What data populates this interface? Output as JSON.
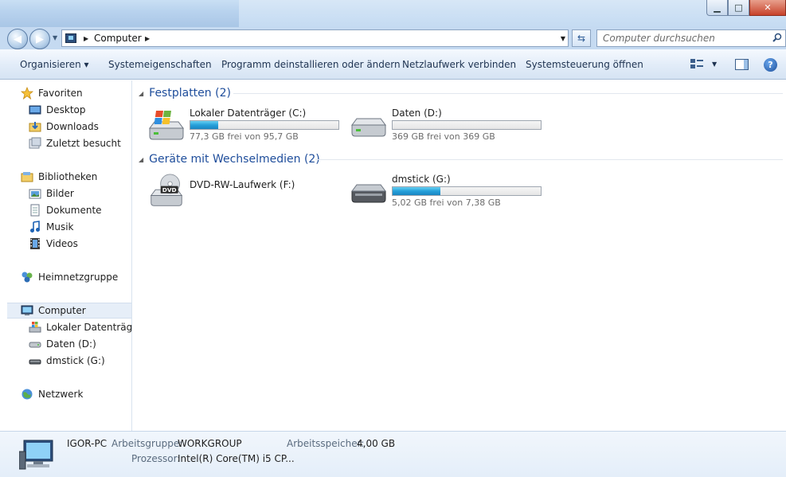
{
  "window": {
    "controls": {
      "minimize": "▁",
      "maximize": "□",
      "close": "✕"
    }
  },
  "navigation": {
    "breadcrumb": [
      "Computer"
    ],
    "search_placeholder": "Computer durchsuchen"
  },
  "toolbar": {
    "items": [
      "Organisieren ▾",
      "Systemeigenschaften",
      "Programm deinstallieren oder ändern",
      "Netzlaufwerk verbinden",
      "Systemsteuerung öffnen"
    ],
    "help": "?"
  },
  "sidebar": {
    "items": [
      {
        "label": "Favoriten",
        "icon": "star-icon"
      },
      {
        "label": "Desktop",
        "icon": "desktop-icon"
      },
      {
        "label": "Downloads",
        "icon": "downloads-folder-icon"
      },
      {
        "label": "Zuletzt besucht",
        "icon": "recent-places-icon"
      },
      {
        "label": "Bibliotheken",
        "icon": "libraries-icon"
      },
      {
        "label": "Bilder",
        "icon": "pictures-icon"
      },
      {
        "label": "Dokumente",
        "icon": "documents-icon"
      },
      {
        "label": "Musik",
        "icon": "music-icon"
      },
      {
        "label": "Videos",
        "icon": "videos-icon"
      },
      {
        "label": "Heimnetzgruppe",
        "icon": "homegroup-icon"
      },
      {
        "label": "Computer",
        "icon": "computer-icon",
        "selected": true
      },
      {
        "label": "Lokaler Datenträger",
        "icon": "windows-drive-icon"
      },
      {
        "label": "Daten (D:)",
        "icon": "hard-drive-icon"
      },
      {
        "label": "dmstick (G:)",
        "icon": "usb-drive-icon"
      },
      {
        "label": "Netzwerk",
        "icon": "network-icon"
      }
    ]
  },
  "main": {
    "groups": [
      {
        "header": "Festplatten (2)",
        "drives": [
          {
            "name": "Lokaler Datenträger (C:)",
            "free": "77,3 GB frei von 95,7 GB",
            "used_fraction": 0.19,
            "icon": "windows-drive-icon"
          },
          {
            "name": "Daten (D:)",
            "free": "369 GB frei von 369 GB",
            "used_fraction": 0.0,
            "icon": "hard-drive-icon"
          }
        ]
      },
      {
        "header": "Geräte mit Wechselmedien (2)",
        "drives": [
          {
            "name": "DVD-RW-Laufwerk (F:)",
            "icon": "dvd-drive-icon"
          },
          {
            "name": "dmstick (G:)",
            "free": "5,02 GB frei von 7,38 GB",
            "used_fraction": 0.32,
            "icon": "usb-drive-icon"
          }
        ]
      }
    ]
  },
  "details": {
    "computer_name": "IGOR-PC",
    "workgroup_label": "Arbeitsgruppe:",
    "workgroup_value": "WORKGROUP",
    "memory_label": "Arbeitsspeicher:",
    "memory_value": "4,00 GB",
    "cpu_label": "Prozessor:",
    "cpu_value": "Intel(R) Core(TM) i5 CP..."
  },
  "colors": {
    "accent": "#1e4d9b",
    "progress": "#26a0da"
  }
}
